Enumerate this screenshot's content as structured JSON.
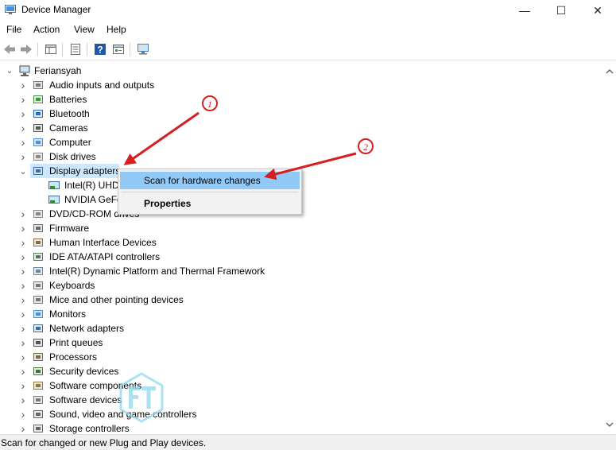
{
  "window": {
    "title": "Device Manager",
    "minimize": "—",
    "maximize": "☐",
    "close": "✕"
  },
  "menu": [
    "File",
    "Action",
    "View",
    "Help"
  ],
  "toolbar_icons": [
    "back-arrow-icon",
    "forward-arrow-icon",
    "properties-icon",
    "list-icon",
    "help-icon",
    "action-icon",
    "monitor-scan-icon"
  ],
  "tree": {
    "root": "Feriansyah",
    "items": [
      {
        "label": "Audio inputs and outputs",
        "icon": "speaker-icon"
      },
      {
        "label": "Batteries",
        "icon": "battery-icon"
      },
      {
        "label": "Bluetooth",
        "icon": "bluetooth-icon"
      },
      {
        "label": "Cameras",
        "icon": "camera-icon"
      },
      {
        "label": "Computer",
        "icon": "computer-icon"
      },
      {
        "label": "Disk drives",
        "icon": "disk-icon"
      },
      {
        "label": "Display adapters",
        "icon": "display-adapter-icon",
        "expanded": true,
        "children": [
          {
            "label": "Intel(R) UHD"
          },
          {
            "label": "NVIDIA GeFo"
          }
        ]
      },
      {
        "label": "DVD/CD-ROM drives",
        "icon": "dvd-icon"
      },
      {
        "label": "Firmware",
        "icon": "firmware-icon"
      },
      {
        "label": "Human Interface Devices",
        "icon": "hid-icon"
      },
      {
        "label": "IDE ATA/ATAPI controllers",
        "icon": "ide-icon"
      },
      {
        "label": "Intel(R) Dynamic Platform and Thermal Framework",
        "icon": "chip-icon"
      },
      {
        "label": "Keyboards",
        "icon": "keyboard-icon"
      },
      {
        "label": "Mice and other pointing devices",
        "icon": "mouse-icon"
      },
      {
        "label": "Monitors",
        "icon": "monitor-icon"
      },
      {
        "label": "Network adapters",
        "icon": "network-icon"
      },
      {
        "label": "Print queues",
        "icon": "printer-icon"
      },
      {
        "label": "Processors",
        "icon": "processor-icon"
      },
      {
        "label": "Security devices",
        "icon": "security-icon"
      },
      {
        "label": "Software components",
        "icon": "software-component-icon"
      },
      {
        "label": "Software devices",
        "icon": "software-device-icon"
      },
      {
        "label": "Sound, video and game controllers",
        "icon": "sound-icon"
      },
      {
        "label": "Storage controllers",
        "icon": "storage-icon"
      }
    ]
  },
  "context_menu": {
    "items": [
      "Scan for hardware changes",
      "Properties"
    ]
  },
  "annotations": [
    "1",
    "2"
  ],
  "status": "Scan for changed or new Plug and Play devices.",
  "colors": {
    "selection": "#cce8ff",
    "menu_highlight": "#91c9f7",
    "annotation": "#d42020"
  }
}
